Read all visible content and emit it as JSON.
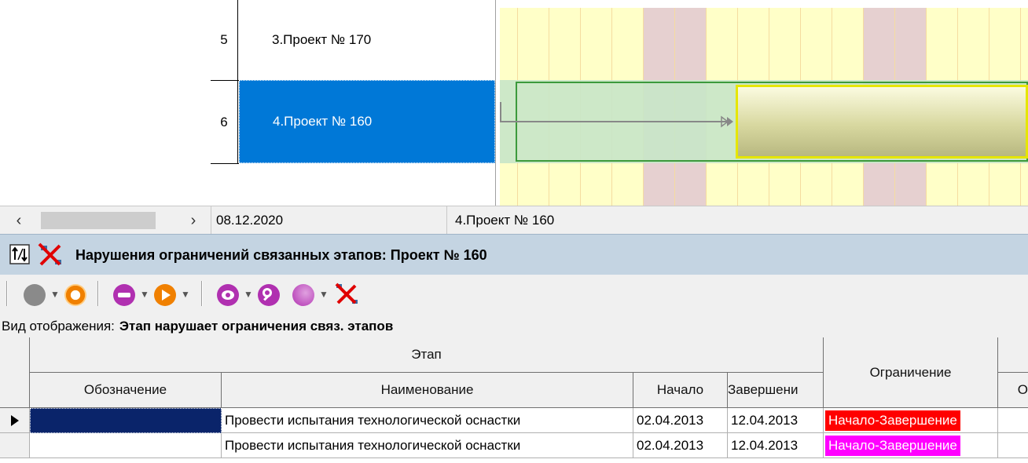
{
  "gantt": {
    "rows": [
      {
        "num": "5",
        "name": "3.Проект № 170"
      },
      {
        "num": "6",
        "name": "4.Проект № 160"
      }
    ]
  },
  "status": {
    "date": "08.12.2020",
    "selected_task": "4.Проект № 160"
  },
  "panel": {
    "title": "Нарушения ограничений связанных этапов: Проект № 160"
  },
  "toolbar": {
    "icons": [
      "stop-icon",
      "refresh-icon",
      "print-icon",
      "play-icon",
      "view-icon",
      "find-icon",
      "globe-icon",
      "delete-link-icon"
    ]
  },
  "view_mode": {
    "label": "Вид отображения:",
    "value": "Этап нарушает ограничения связ. этапов"
  },
  "grid": {
    "group_header": "Этап",
    "constraint_header": "Ограничение",
    "partial_header": "О",
    "columns": [
      "Обозначение",
      "Наименование",
      "Начало",
      "Завершени"
    ],
    "rows": [
      {
        "designation": "",
        "name": "Провести испытания технологической оснастки",
        "start": "02.04.2013",
        "end": "12.04.2013",
        "constraint": "Начало-Завершение",
        "constraint_color": "#ff0000"
      },
      {
        "designation": "",
        "name": "Провести испытания технологической оснастки",
        "start": "02.04.2013",
        "end": "12.04.2013",
        "constraint": "Начало-Завершение",
        "constraint_color": "#ff00ff"
      }
    ]
  },
  "colors": {
    "selection": "#0078d7",
    "panel_header": "#c4d4e2"
  }
}
